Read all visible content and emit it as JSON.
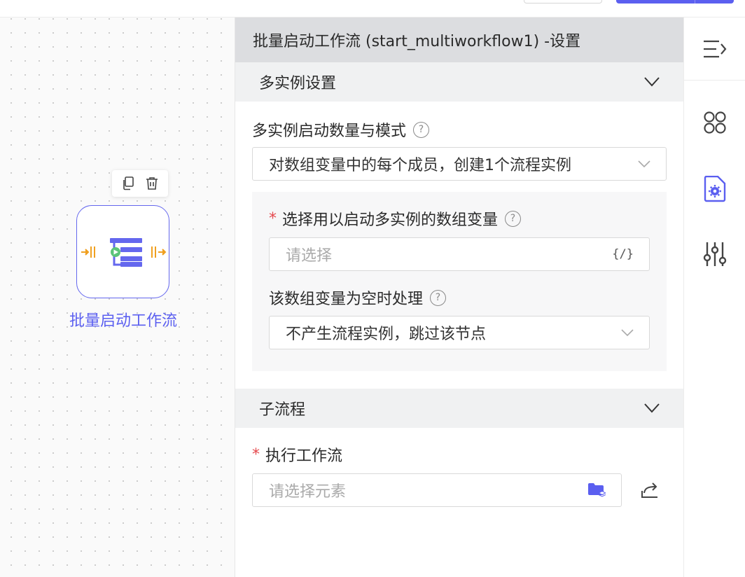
{
  "canvas": {
    "node": {
      "label": "批量启动工作流"
    },
    "toolbar": {
      "copy": "copy-icon",
      "delete": "trash-icon"
    }
  },
  "panel": {
    "title": "批量启动工作流 (start_multiworkflow1) -设置",
    "multi_instance": {
      "header": "多实例设置",
      "mode_label": "多实例启动数量与模式",
      "mode_value": "对数组变量中的每个成员，创建1个流程实例",
      "array_var_label": "选择用以启动多实例的数组变量",
      "array_var_placeholder": "请选择",
      "array_var_suffix": "{/}",
      "empty_label": "该数组变量为空时处理",
      "empty_value": "不产生流程实例，跳过该节点"
    },
    "subprocess": {
      "header": "子流程",
      "exec_label": "执行工作流",
      "exec_placeholder": "请选择元素"
    },
    "required_mark": "*",
    "help_mark": "?"
  },
  "rail": {
    "icons": [
      "collapse-icon",
      "components-icon",
      "settings-doc-icon",
      "sliders-icon"
    ]
  },
  "colors": {
    "accent": "#5b5ff0",
    "node_port": "#f0a020",
    "node_play": "#5cc47a",
    "required": "#e5484d"
  }
}
